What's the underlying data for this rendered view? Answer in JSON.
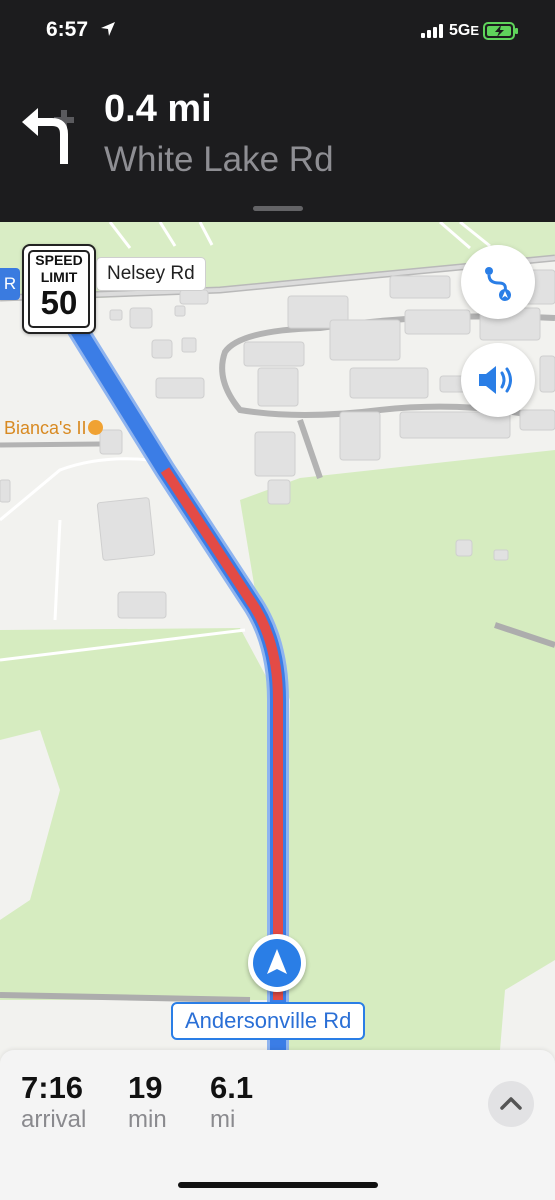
{
  "status_bar": {
    "time": "6:57",
    "network": "5G",
    "network_sub": "E",
    "location_icon": "location-arrow-icon",
    "signal_icon": "cellular-signal-icon",
    "battery_icon": "battery-charging-icon"
  },
  "guidance": {
    "turn_icon": "turn-left-icon",
    "distance": "0.4 mi",
    "street": "White Lake Rd"
  },
  "map": {
    "speed_limit": {
      "label_line1": "SPEED",
      "label_line2": "LIMIT",
      "value": "50"
    },
    "cross_road": "Nelsey Rd",
    "offscreen_tag": "R",
    "poi": {
      "name": "Bianca's II",
      "icon": "restaurant-icon"
    },
    "current_road": "Andersonville Rd",
    "buttons": {
      "route_overview_icon": "route-overview-icon",
      "audio_icon": "speaker-icon"
    },
    "colors": {
      "route_blue": "#3b7de6",
      "traffic_red": "#e34b46",
      "park_green": "#d6ecc0",
      "land_gray": "#f2f2ef"
    }
  },
  "trip": {
    "arrival_time": "7:16",
    "arrival_label": "arrival",
    "minutes": "19",
    "minutes_label": "min",
    "distance": "6.1",
    "distance_label": "mi",
    "expand_icon": "chevron-up-icon"
  }
}
